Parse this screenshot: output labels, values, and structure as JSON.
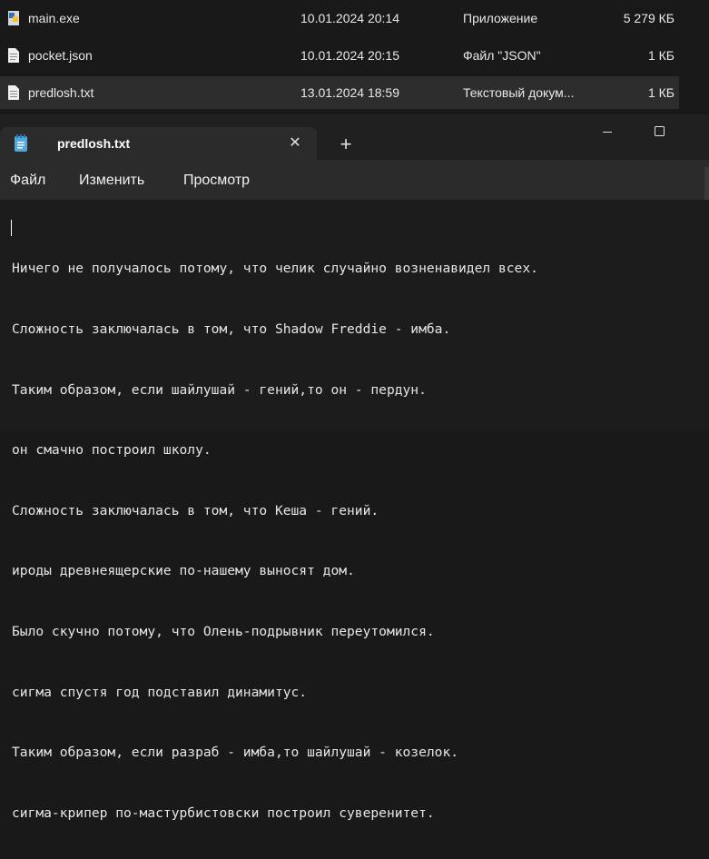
{
  "explorer": {
    "files": [
      {
        "name": "main.exe",
        "date": "10.01.2024 20:14",
        "type": "Приложение",
        "size": "5 279 КБ",
        "icon": "exe-file-icon"
      },
      {
        "name": "pocket.json",
        "date": "10.01.2024 20:15",
        "type": "Файл \"JSON\"",
        "size": "1 КБ",
        "icon": "json-file-icon"
      },
      {
        "name": "predlosh.txt",
        "date": "13.01.2024 18:59",
        "type": "Текстовый докум...",
        "size": "1 КБ",
        "icon": "text-file-icon"
      }
    ]
  },
  "notepad": {
    "tab_title": "predlosh.txt",
    "close_glyph": "✕",
    "new_tab_glyph": "+",
    "menu": {
      "file": "Файл",
      "edit": "Изменить",
      "view": "Просмотр"
    },
    "lines": [
      "Ничего не получалось потому, что челик случайно возненавидел всех.",
      "Сложность заключалась в том, что Shadow Freddie - имба.",
      "Таким образом, если шайлушай - гений,то он - пердун.",
      "он смачно построил школу.",
      "Сложность заключалась в том, что Кеша - гений.",
      "ироды древнеящерские по-нашему выносят дом.",
      "Было скучно потому, что Олень-подрывник переутомился.",
      "сигма спустя год подставил динамитус.",
      "Таким образом, если разраб - имба,то шайлушай - козелок.",
      "сигма-крипер по-мастурбистовски построил суверенитет."
    ]
  },
  "colors": {
    "background": "#191919",
    "tab": "#2b2b2b",
    "editor": "#1c1c1c",
    "text": "#e6e6e6",
    "notepad_icon": "#4fa8e0"
  }
}
